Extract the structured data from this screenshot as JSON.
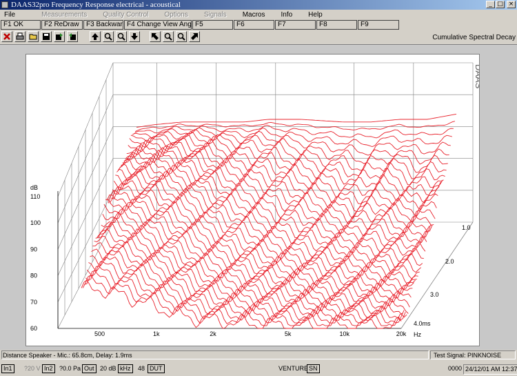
{
  "window": {
    "title": "DAAS32pro Frequency Response electrical - acoustical",
    "min_icon": "minimize-icon",
    "max_icon": "maximize-icon",
    "close_icon": "close-icon"
  },
  "menu": [
    "File",
    "Measurements",
    "Quality Control",
    "Options",
    "Signals",
    "Macros",
    "Info",
    "Help"
  ],
  "menu_disabled": [
    false,
    true,
    true,
    true,
    true,
    false,
    false,
    false
  ],
  "fkeys": [
    "F1 OK",
    "F2 ReDraw",
    "F3 Backward",
    "F4 Change View Angle",
    "F5",
    "F6",
    "F7",
    "F8",
    "F9"
  ],
  "toolbar": [
    "exit-icon",
    "print-icon",
    "open-icon",
    "save-icon",
    "export-icon",
    "import-icon",
    "arrow-up-icon",
    "zoom-in-icon",
    "zoom-out-icon",
    "arrow-down-icon",
    "arrow-upleft-icon",
    "zoom-in-icon",
    "zoom-out-icon",
    "arrow-upright-icon"
  ],
  "view_label": "Cumulative Spectral Decay",
  "graph": {
    "brand": "DAAS",
    "y_unit": "dB",
    "y_ticks": [
      "110",
      "100",
      "90",
      "80",
      "70",
      "60"
    ],
    "x_ticks": [
      "500",
      "1k",
      "2k",
      "5k",
      "10k",
      "20k"
    ],
    "x_unit": "Hz",
    "time_ticks": [
      "1.0",
      "2.0",
      "3.0",
      "4.0ms"
    ],
    "trace_color": "#e8202a",
    "grid_color": "#808080"
  },
  "chart_data": {
    "type": "line",
    "title": "Cumulative Spectral Decay",
    "ylabel": "dB",
    "xlabel": "Hz",
    "zlabel": "ms",
    "x_scale": "log",
    "x": [
      400,
      500,
      700,
      1000,
      1500,
      2000,
      3000,
      5000,
      7000,
      10000,
      14000,
      20000
    ],
    "ylim": [
      60,
      110
    ],
    "time_ticks_ms": [
      1.0,
      2.0,
      3.0,
      4.0
    ],
    "series": [
      {
        "values": [
          96,
          97,
          98,
          98,
          98,
          99,
          99,
          98,
          98,
          99,
          99,
          101
        ]
      },
      {
        "values": [
          95,
          96,
          97,
          97,
          95,
          96,
          93,
          90,
          88,
          92,
          88,
          90
        ]
      },
      {
        "values": [
          93,
          95,
          96,
          94,
          90,
          89,
          86,
          82,
          80,
          84,
          80,
          84
        ]
      },
      {
        "values": [
          91,
          93,
          93,
          90,
          84,
          82,
          78,
          76,
          74,
          77,
          74,
          78
        ]
      },
      {
        "values": [
          88,
          90,
          88,
          84,
          78,
          75,
          72,
          70,
          70,
          70,
          70,
          72
        ]
      },
      {
        "values": [
          84,
          86,
          83,
          78,
          72,
          70,
          68,
          67,
          66,
          66,
          66,
          67
        ]
      },
      {
        "values": [
          80,
          81,
          78,
          73,
          68,
          66,
          65,
          64,
          63,
          63,
          63,
          64
        ]
      },
      {
        "values": [
          75,
          75,
          72,
          68,
          64,
          63,
          62,
          61,
          61,
          61,
          61,
          61
        ]
      }
    ]
  },
  "status": {
    "left": "Distance Speaker - Mic.: 65.8cm, Delay: 1.9ms",
    "right": "Test Signal: PINKNOISE"
  },
  "statusbar": {
    "in1": "In1",
    "v": "?20 V",
    "in2": "In2",
    "pa": "?0.0 Pa",
    "out": "Out",
    "db": "20 dB",
    "khz": "kHz",
    "n48": "48",
    "dut": "DUT",
    "venture": "VENTURE",
    "sn": "SN",
    "counter": "0000",
    "datetime": "24/12/01 AM 12:37:53"
  }
}
